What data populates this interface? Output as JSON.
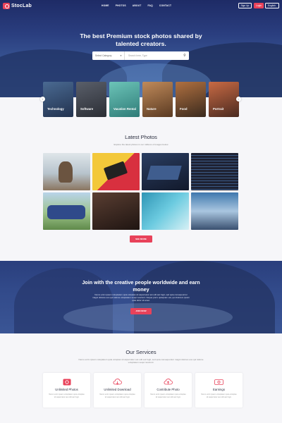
{
  "brand": {
    "name": "StocLab",
    "accent": "#e8425a",
    "navy": "#1e2b66"
  },
  "nav": {
    "links": [
      "HOME",
      "PHOTOS",
      "ABOUT",
      "FAQ",
      "CONTACT"
    ],
    "signup": "Sign Up",
    "login": "Login",
    "language": "English"
  },
  "hero": {
    "title": "The best Premium stock photos shared by talented creators.",
    "search": {
      "category": "Select Category",
      "placeholder": "Search here, Type",
      "icon": "search-icon"
    }
  },
  "categories": [
    {
      "label": "Technology",
      "color": "#334a6e"
    },
    {
      "label": "Software",
      "color": "#3c3f48"
    },
    {
      "label": "Vacation Rental",
      "color": "#3e9b94"
    },
    {
      "label": "Nature",
      "color": "#8a5a3a"
    },
    {
      "label": "Food",
      "color": "#6b3f2a"
    },
    {
      "label": "Portrait",
      "color": "#7a3f2f"
    }
  ],
  "latest": {
    "title": "Latest Photos",
    "subtitle": "Explore the latest photos in our millions of images below",
    "button": "SEE MORE",
    "photos": [
      {
        "name": "deer",
        "colors": [
          "#cfd8de",
          "#7b6a58"
        ]
      },
      {
        "name": "cassette",
        "colors": [
          "#f3c83a",
          "#d8303f"
        ]
      },
      {
        "name": "laptop-desk",
        "colors": [
          "#1c2a45",
          "#3a5a8a"
        ]
      },
      {
        "name": "code-screen",
        "colors": [
          "#1e2233",
          "#4a6a8a"
        ]
      },
      {
        "name": "team-group",
        "colors": [
          "#7aa86a",
          "#2f4a8a"
        ]
      },
      {
        "name": "woman-portrait",
        "colors": [
          "#2a1e1a",
          "#6b4a3a"
        ]
      },
      {
        "name": "surfers",
        "colors": [
          "#4fb0c8",
          "#a8dce8"
        ]
      },
      {
        "name": "mountains",
        "colors": [
          "#2a4f7a",
          "#d8e4ee"
        ]
      }
    ]
  },
  "join": {
    "title": "Join with the creative people worldwide and earn money",
    "text": "Nemo enim ipsam voluptatem quia voluptas sit aspernatur aut odit aut fugit, sed quia consequuntur magni dolores eos qui ratione voluptatem sequi nesciunt. Neque porro quisquam est, qui dolorem ipsum quia dolor sit amet.",
    "button": "JOIN NOW"
  },
  "services": {
    "title": "Our Services",
    "subtitle": "Nemo enim ipsam voluptatem quia voluptas sit aspernatur aut odit aut fugit, sed quia consequuntur magni dolores eos qui ratione voluptatem sequi nesciunt.",
    "items": [
      {
        "title": "Unlimited Photos",
        "icon": "photo-icon",
        "text": "Nemo enim ipsam voluptatem quia voluptas sit aspernatur aut odit aut fugit."
      },
      {
        "title": "Unlimited Download",
        "icon": "cloud-download-icon",
        "text": "Nemo enim ipsam voluptatem quia voluptas sit aspernatur aut odit aut fugit."
      },
      {
        "title": "Contribute Photo",
        "icon": "cloud-upload-icon",
        "text": "Nemo enim ipsam voluptatem quia voluptas sit aspernatur aut odit aut fugit."
      },
      {
        "title": "Earnings",
        "icon": "money-icon",
        "text": "Nemo enim ipsam voluptatem quia voluptas sit aspernatur aut odit aut fugit."
      }
    ]
  }
}
